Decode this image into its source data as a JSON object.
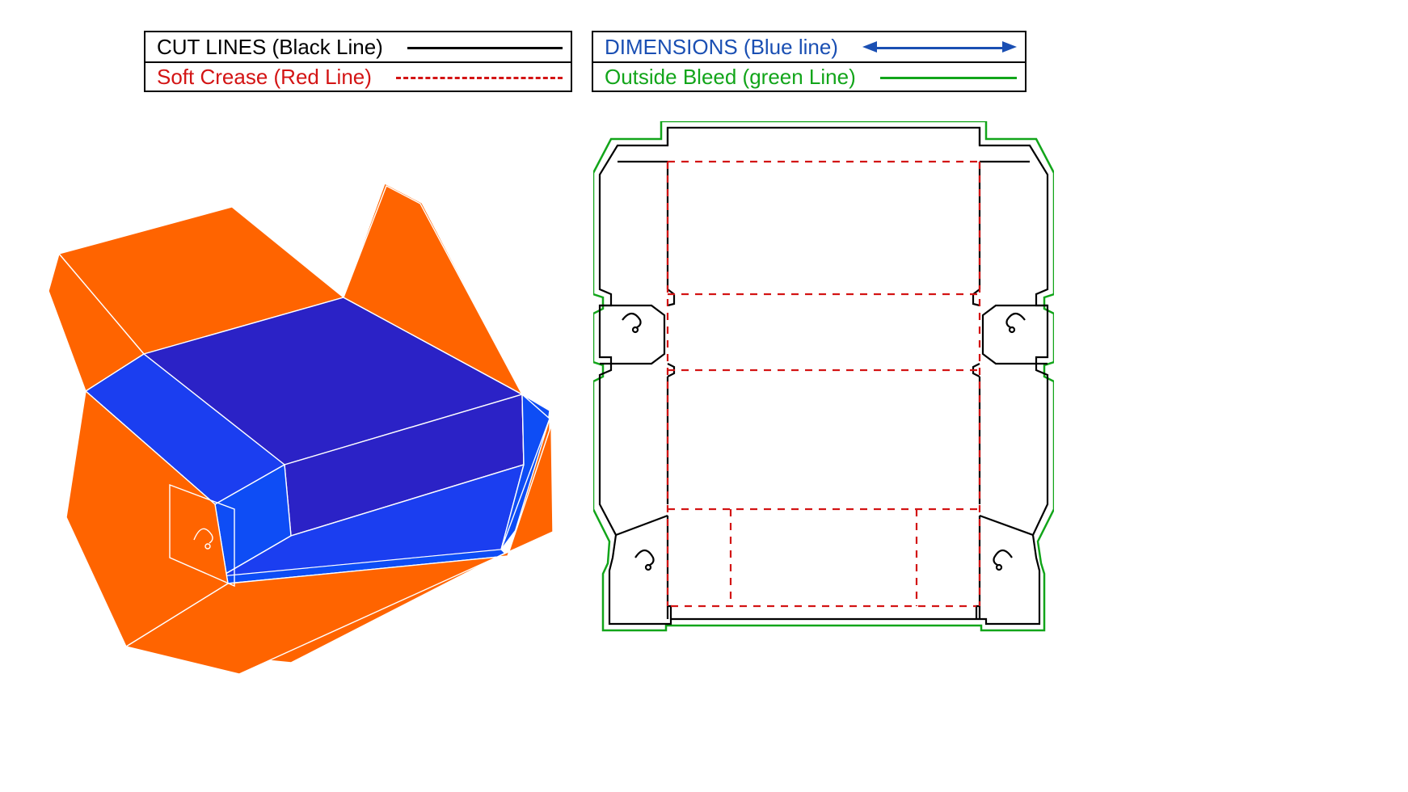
{
  "legend": {
    "left": {
      "row1": {
        "label": "CUT LINES (Black Line)",
        "style": "solid-black",
        "color": "lbl-black"
      },
      "row2": {
        "label": "Soft Crease (Red Line)",
        "style": "dashed-red",
        "color": "lbl-red"
      }
    },
    "right": {
      "row1": {
        "label": "DIMENSIONS (Blue line)",
        "style": "dim-blue-arrow",
        "color": "lbl-blue"
      },
      "row2": {
        "label": "Outside Bleed (green Line)",
        "style": "solid-green",
        "color": "lbl-green"
      }
    }
  },
  "colors": {
    "cut": "#000000",
    "crease": "#d31414",
    "bleed": "#12a51a",
    "dimension": "#1a4fb3",
    "box_outer": "#ff6400",
    "box_inner_mid": "#1b3ef0",
    "box_inner_dark": "#2b22c6",
    "box_inner_bright": "#0e4df5",
    "edge": "#ffffff"
  },
  "diagram": {
    "type": "packaging-dieline",
    "description": "Corrugated mailer / shoe-box style dieline with hinged lid and side locking tabs, plus 3D open-box render."
  }
}
